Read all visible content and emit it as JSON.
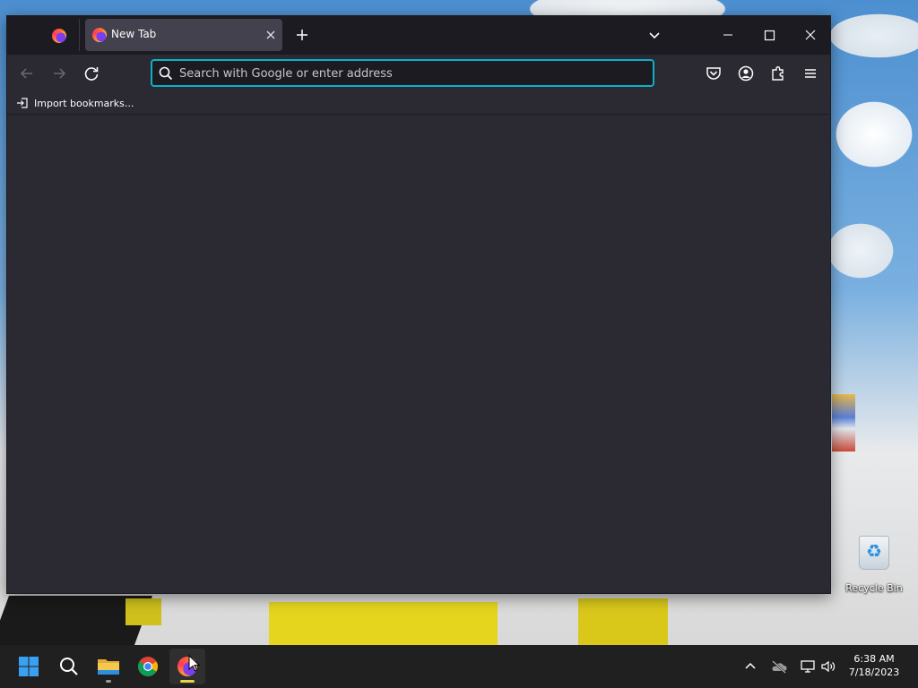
{
  "browser": {
    "tab": {
      "title": "New Tab"
    },
    "urlbar": {
      "placeholder": "Search with Google or enter address",
      "value": ""
    },
    "bookmarks_bar": {
      "import_label": "Import bookmarks..."
    },
    "colors": {
      "accent": "#0db0c6",
      "toolbar": "#2b2a33",
      "tabstrip": "#1c1b22"
    }
  },
  "desktop": {
    "icons": [
      {
        "label": "Recycle Bin",
        "icon": "recycle-bin-icon"
      }
    ]
  },
  "taskbar": {
    "pinned": [
      "start-icon",
      "search-icon",
      "file-explorer-icon",
      "chrome-icon",
      "firefox-icon"
    ],
    "tray": [
      "chevron-up-icon",
      "onedrive-icon",
      "network-icon",
      "volume-icon"
    ],
    "clock": {
      "time": "6:38 AM",
      "date": "7/18/2023"
    }
  }
}
